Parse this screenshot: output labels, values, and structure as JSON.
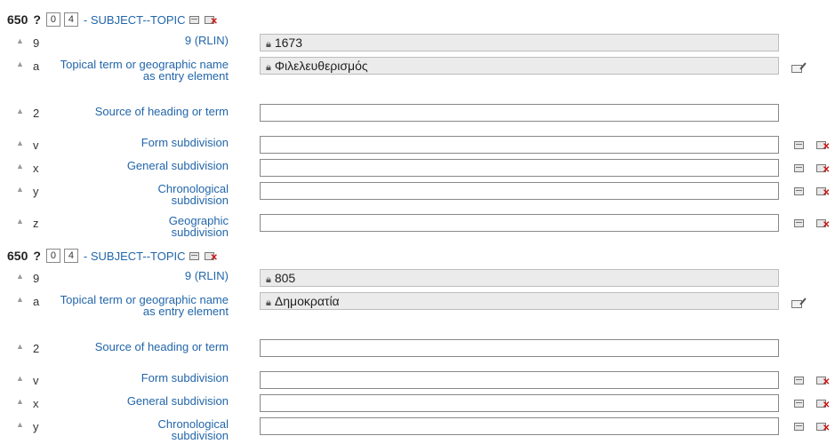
{
  "fields": [
    {
      "tag": "650",
      "help": "?",
      "ind1": "0",
      "ind2": "4",
      "desc": "- SUBJECT--TOPIC",
      "subfields": [
        {
          "code": "9",
          "label": "9 (RLIN)",
          "value": "1673",
          "locked": true
        },
        {
          "code": "a",
          "label": "Topical term or geographic name as entry element",
          "value": "Φιλελευθερισμός",
          "locked": true
        },
        {
          "code": "2",
          "label": "Source of heading or term",
          "value": "",
          "locked": false
        },
        {
          "code": "v",
          "label": "Form subdivision",
          "value": "",
          "locked": false
        },
        {
          "code": "x",
          "label": "General subdivision",
          "value": "",
          "locked": false
        },
        {
          "code": "y",
          "label": "Chronological subdivision",
          "value": "",
          "locked": false
        },
        {
          "code": "z",
          "label": "Geographic subdivision",
          "value": "",
          "locked": false
        }
      ]
    },
    {
      "tag": "650",
      "help": "?",
      "ind1": "0",
      "ind2": "4",
      "desc": "- SUBJECT--TOPIC",
      "subfields": [
        {
          "code": "9",
          "label": "9 (RLIN)",
          "value": "805",
          "locked": true
        },
        {
          "code": "a",
          "label": "Topical term or geographic name as entry element",
          "value": "Δημοκρατία",
          "locked": true
        },
        {
          "code": "2",
          "label": "Source of heading or term",
          "value": "",
          "locked": false
        },
        {
          "code": "v",
          "label": "Form subdivision",
          "value": "",
          "locked": false
        },
        {
          "code": "x",
          "label": "General subdivision",
          "value": "",
          "locked": false
        },
        {
          "code": "y",
          "label": "Chronological subdivision",
          "value": "",
          "locked": false
        }
      ]
    }
  ],
  "icons": {
    "lock": "lock-icon",
    "arrow": "move-up-icon",
    "clone": "clone-icon",
    "delete": "delete-icon",
    "edit": "edit-icon"
  }
}
